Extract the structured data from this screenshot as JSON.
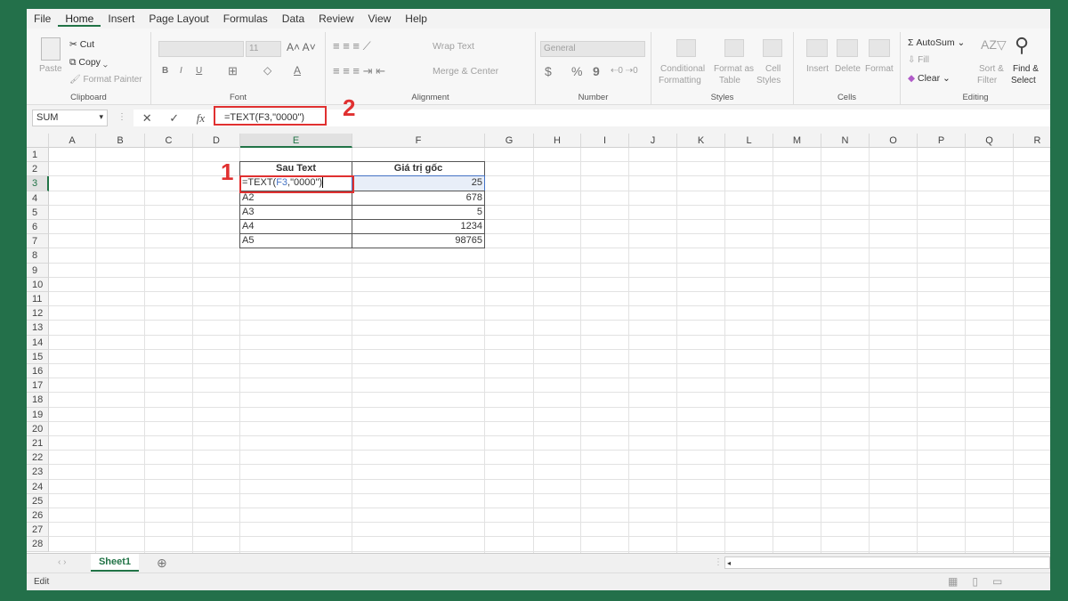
{
  "menu": [
    "File",
    "Home",
    "Insert",
    "Page Layout",
    "Formulas",
    "Data",
    "Review",
    "View",
    "Help"
  ],
  "ribbon": {
    "clipboard": {
      "paste": "Paste",
      "cut": "Cut",
      "copy": "Copy",
      "format_painter": "Format Painter",
      "label": "Clipboard"
    },
    "font": {
      "size": "11",
      "label": "Font",
      "bold": "B",
      "italic": "I",
      "underline": "U"
    },
    "alignment": {
      "wrap": "Wrap Text",
      "merge": "Merge & Center",
      "label": "Alignment"
    },
    "number": {
      "format": "General",
      "currency": "$",
      "percent": "%",
      "comma": "9",
      "label": "Number"
    },
    "styles": {
      "conditional": "Conditional",
      "conditional2": "Formatting",
      "format_as": "Format as",
      "format_as2": "Table",
      "cell": "Cell",
      "cell2": "Styles",
      "label": "Styles"
    },
    "cells": {
      "insert": "Insert",
      "delete": "Delete",
      "format": "Format",
      "label": "Cells"
    },
    "editing": {
      "autosum": "AutoSum",
      "fill": "Fill",
      "clear": "Clear",
      "sort": "Sort &",
      "sort2": "Filter",
      "find": "Find &",
      "find2": "Select",
      "label": "Editing"
    }
  },
  "formula_bar": {
    "name_box": "SUM",
    "fx": "fx",
    "formula": "=TEXT(F3,\"0000\")"
  },
  "annotations": {
    "one": "1",
    "two": "2"
  },
  "columns": [
    "A",
    "B",
    "C",
    "D",
    "E",
    "F",
    "G",
    "H",
    "I",
    "J",
    "K",
    "L",
    "M",
    "N",
    "O",
    "P",
    "Q",
    "R"
  ],
  "rows": [
    "1",
    "2",
    "3",
    "4",
    "5",
    "6",
    "7",
    "8",
    "9",
    "10",
    "11",
    "12",
    "13",
    "14",
    "15",
    "16",
    "17",
    "18",
    "19",
    "20",
    "21",
    "22",
    "23",
    "24",
    "25",
    "26",
    "27",
    "28"
  ],
  "table": {
    "headers": [
      "Sau Text",
      "Giá trị gốc"
    ],
    "editing_cell": {
      "prefix": "=TEXT(",
      "ref": "F3",
      "suffix": ",\"0000\")"
    },
    "rows": [
      [
        "",
        "25"
      ],
      [
        "A2",
        "678"
      ],
      [
        "A3",
        "5"
      ],
      [
        "A4",
        "1234"
      ],
      [
        "A5",
        "98765"
      ]
    ]
  },
  "sheet_tabs": [
    "Sheet1"
  ],
  "status": "Edit",
  "colors": {
    "excel_green": "#217346",
    "annotation_red": "#e03030",
    "ref_blue": "#4472c4"
  }
}
